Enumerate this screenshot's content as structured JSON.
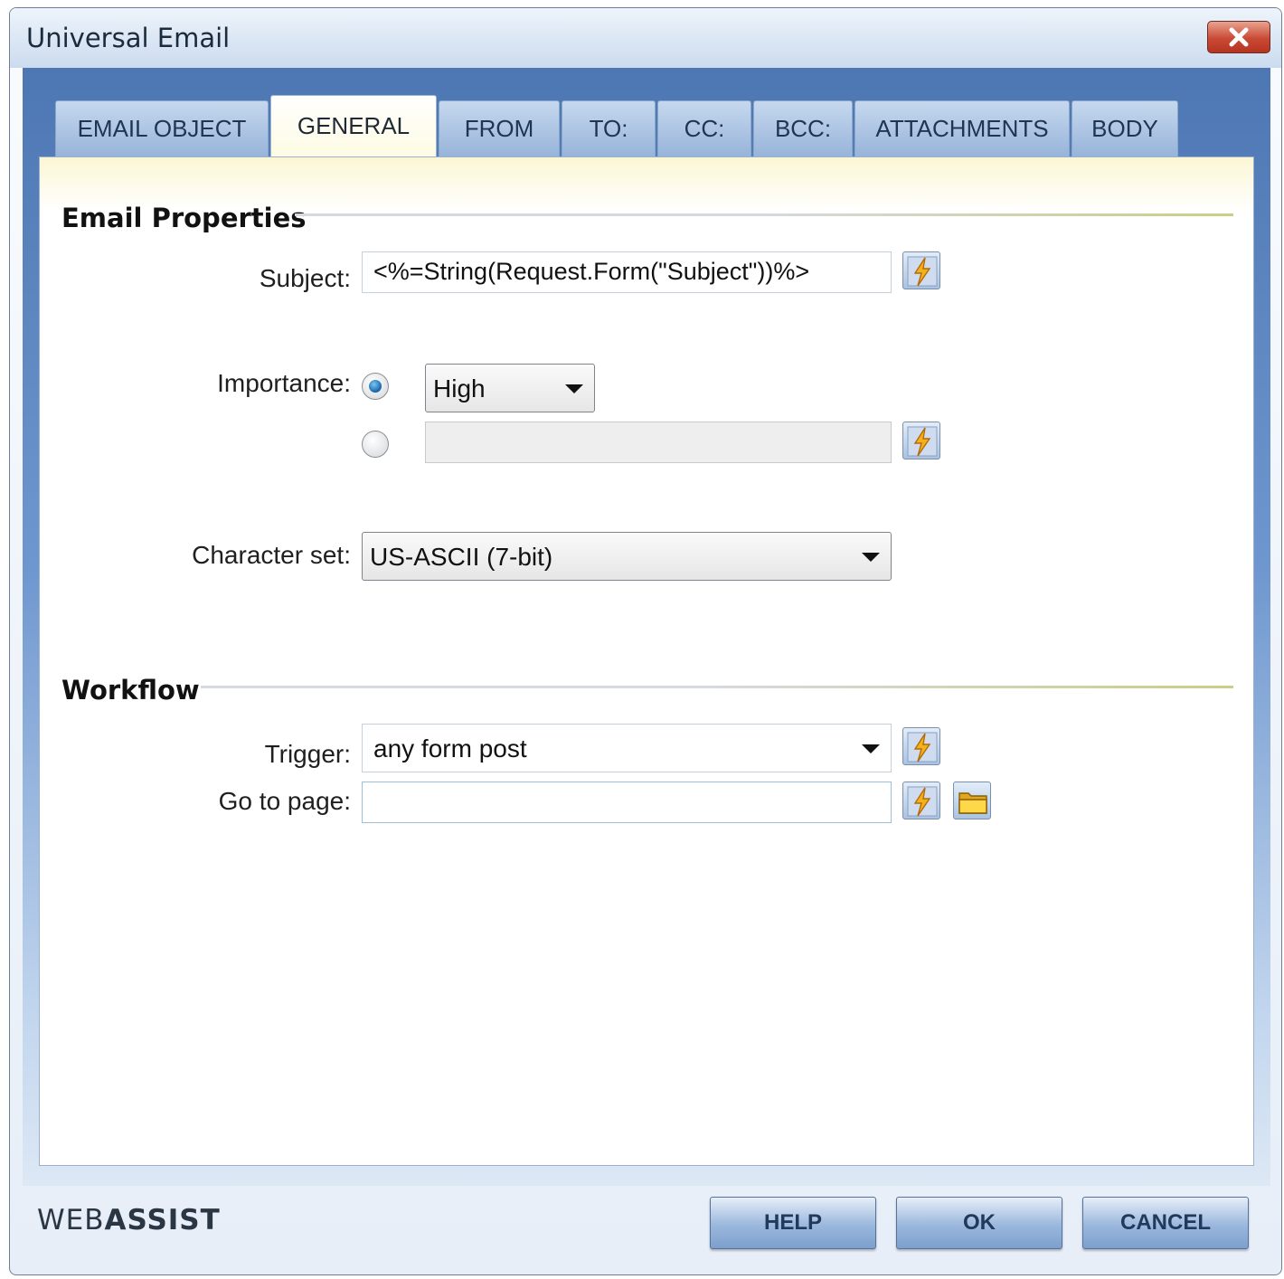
{
  "window": {
    "title": "Universal Email"
  },
  "tabs": [
    {
      "label": "EMAIL OBJECT"
    },
    {
      "label": "GENERAL"
    },
    {
      "label": "FROM"
    },
    {
      "label": "TO:"
    },
    {
      "label": "CC:"
    },
    {
      "label": "BCC:"
    },
    {
      "label": "ATTACHMENTS"
    },
    {
      "label": "BODY"
    }
  ],
  "active_tab": "GENERAL",
  "email_properties": {
    "title": "Email Properties",
    "subject_label": "Subject:",
    "subject_value": "<%=String(Request.Form(\"Subject\"))%>",
    "importance_label": "Importance:",
    "importance_select": "High",
    "importance_custom_value": "",
    "charset_label": "Character set:",
    "charset_value": "US-ASCII (7-bit)"
  },
  "workflow": {
    "title": "Workflow",
    "trigger_label": "Trigger:",
    "trigger_value": "any form post",
    "goto_label": "Go to page:",
    "goto_value": ""
  },
  "footer": {
    "logo_part1": "WEB",
    "logo_part2": "ASSIST",
    "help_label": "HELP",
    "ok_label": "OK",
    "cancel_label": "CANCEL"
  },
  "icons": {
    "dynamic_data": "lightning-bolt-icon",
    "browse": "folder-icon",
    "close": "close-x-icon"
  },
  "colors": {
    "frame_blue": "#4d77b3",
    "panel_header": "#fbf6d4",
    "close_red": "#c94a35",
    "button_blue": "#9ab7dd"
  }
}
